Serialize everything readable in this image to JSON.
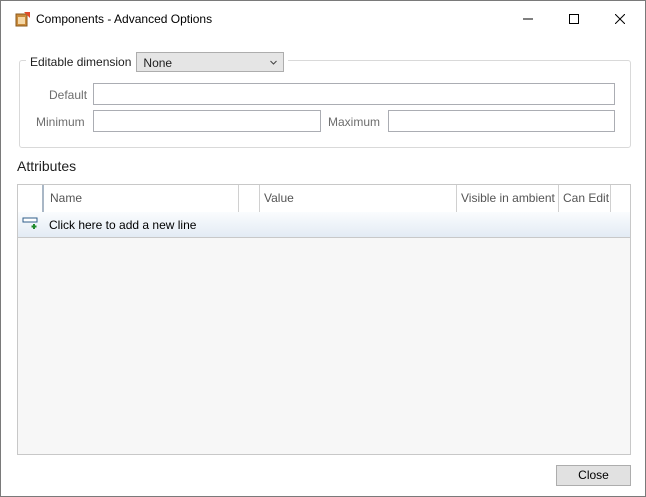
{
  "window": {
    "title": "Components - Advanced Options"
  },
  "dimension": {
    "label": "Editable dimension",
    "selected": "None",
    "default_label": "Default",
    "default_value": "",
    "minimum_label": "Minimum",
    "minimum_value": "",
    "maximum_label": "Maximum",
    "maximum_value": ""
  },
  "attributes": {
    "title": "Attributes",
    "columns": [
      "Name",
      "",
      "Value",
      "Visible in ambient",
      "Can Edit"
    ],
    "new_line_text": "Click here to add a new line"
  },
  "footer": {
    "close_label": "Close"
  },
  "icons": {
    "app": "components-app-icon",
    "minimize": "minimize-icon",
    "maximize": "maximize-icon",
    "close": "close-icon",
    "dropdown": "chevron-down-icon",
    "add_row": "add-row-icon"
  }
}
